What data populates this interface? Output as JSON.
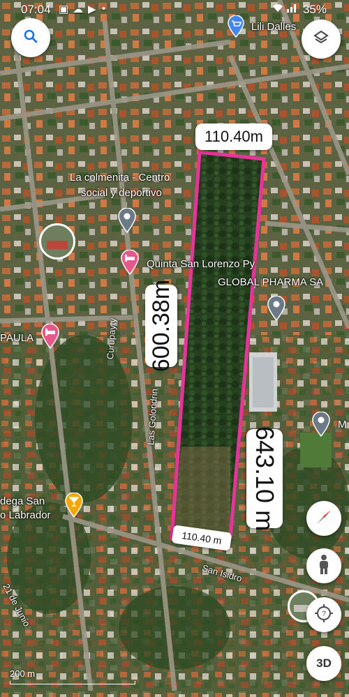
{
  "status_bar": {
    "time": "07:04",
    "battery": "35%"
  },
  "places": {
    "lili_dalles": "Lili Dalles",
    "la_colmenita_line1": "La colmenita - Centro",
    "la_colmenita_line2": "social y deportivo",
    "quinta_san_lorenzo": "Quinta San Lorenzo Py",
    "global_pharma": "GLOBAL PHARMA SA",
    "paula": "PAULA",
    "bodega_line1": "dega San",
    "bodega_line2": "o Labrador",
    "edge_m": "M"
  },
  "streets": {
    "curupayty": "Curupayty",
    "las_golondrinas": "Las Golondrin",
    "san_isidro": "San Isidro",
    "veintiuno_de_junio": "21 de Junio"
  },
  "measurements": {
    "top_edge": "110.40m",
    "bottom_edge": "110.40 m",
    "left_side": "600.38m",
    "right_side": "643.10 m",
    "outline_color": "#e8339a"
  },
  "controls": {
    "search_icon": "search-icon",
    "layers_icon": "layers-icon",
    "compass_icon": "compass-icon",
    "pegman_icon": "street-view-person-icon",
    "my_location_icon": "location-icon",
    "three_d_label": "3D"
  },
  "scale": {
    "label": "200 m"
  }
}
